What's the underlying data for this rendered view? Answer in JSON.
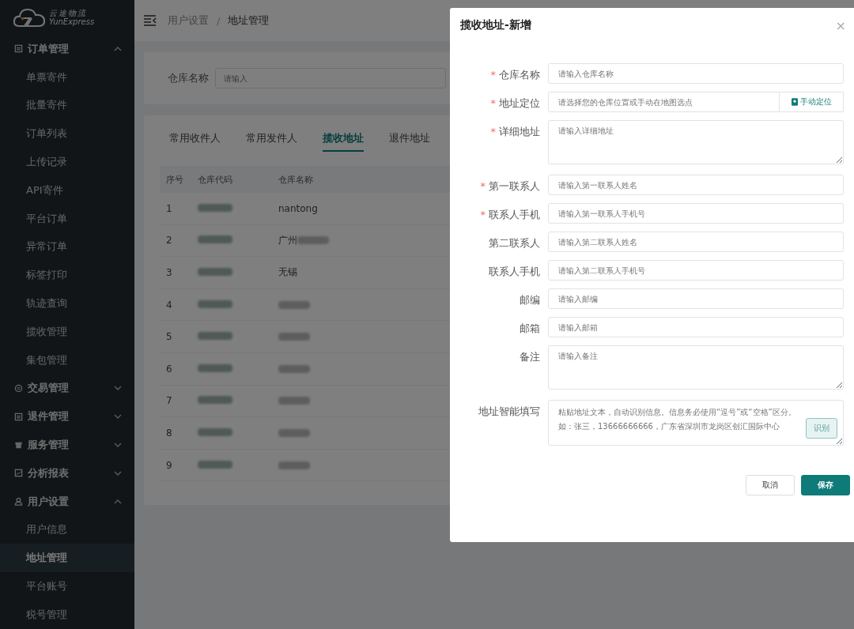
{
  "sidebar": {
    "logo": {
      "cn": "云途物流",
      "en": "YunExpress"
    },
    "groups": [
      {
        "label": "订单管理",
        "kind": "doc",
        "expanded": true,
        "children": [
          {
            "label": "单票寄件",
            "selected": false
          },
          {
            "label": "批量寄件",
            "selected": false
          },
          {
            "label": "订单列表",
            "selected": false
          },
          {
            "label": "上传记录",
            "selected": false
          },
          {
            "label": "API寄件",
            "selected": false
          },
          {
            "label": "平台订单",
            "selected": false
          },
          {
            "label": "异常订单",
            "selected": false
          },
          {
            "label": "标签打印",
            "selected": false
          },
          {
            "label": "轨迹查询",
            "selected": false
          },
          {
            "label": "揽收管理",
            "selected": false
          },
          {
            "label": "集包管理",
            "selected": false
          }
        ]
      },
      {
        "label": "交易管理",
        "kind": "coin",
        "expanded": false
      },
      {
        "label": "退件管理",
        "kind": "doc",
        "expanded": false
      },
      {
        "label": "服务管理",
        "kind": "bin",
        "expanded": false
      },
      {
        "label": "分析报表",
        "kind": "chart",
        "expanded": false
      },
      {
        "label": "用户设置",
        "kind": "user",
        "expanded": true,
        "children": [
          {
            "label": "用户信息",
            "selected": false
          },
          {
            "label": "地址管理",
            "selected": true
          },
          {
            "label": "平台账号",
            "selected": false
          },
          {
            "label": "税号管理",
            "selected": false
          }
        ]
      }
    ]
  },
  "breadcrumb": {
    "items": [
      "用户设置",
      "地址管理"
    ],
    "separator": "/"
  },
  "search": {
    "label": "仓库名称",
    "placeholder": "请输入"
  },
  "tabs": [
    {
      "label": "常用收件人",
      "selected": false
    },
    {
      "label": "常用发件人",
      "selected": false
    },
    {
      "label": "揽收地址",
      "selected": true
    },
    {
      "label": "退件地址",
      "selected": false
    }
  ],
  "table": {
    "columns": [
      "序号",
      "仓库代码",
      "仓库名称"
    ],
    "rows": [
      {
        "no": "1",
        "name": "nantong"
      },
      {
        "no": "2",
        "name": "广州",
        "name_blurred": true
      },
      {
        "no": "3",
        "name": "无锡"
      },
      {
        "no": "4",
        "name_blurred": true
      },
      {
        "no": "5",
        "name_blurred": true
      },
      {
        "no": "6",
        "name_blurred": true
      },
      {
        "no": "7",
        "name_blurred": true
      },
      {
        "no": "8",
        "name_blurred": true
      },
      {
        "no": "9",
        "name_blurred": true
      }
    ]
  },
  "dialog": {
    "title": "揽收地址-新增",
    "close": "×",
    "fields": [
      {
        "label": "仓库名称",
        "required_mark": "*",
        "kind": "input",
        "placeholder": "请输入仓库名称"
      },
      {
        "label": "地址定位",
        "required_mark": "*",
        "kind": "locate",
        "placeholder": "请选择您的仓库位置或手动在地图选点",
        "button": "手动定位"
      },
      {
        "label": "详细地址",
        "required_mark": "*",
        "kind": "textarea",
        "placeholder": "请输入详细地址"
      },
      {
        "label": "第一联系人",
        "required_mark": "*",
        "kind": "input",
        "placeholder": "请输入第一联系人姓名"
      },
      {
        "label": "联系人手机",
        "required_mark": "*",
        "kind": "input",
        "placeholder": "请输入第一联系人手机号"
      },
      {
        "label": "第二联系人",
        "kind": "input",
        "placeholder": "请输入第二联系人姓名"
      },
      {
        "label": "联系人手机",
        "kind": "input",
        "placeholder": "请输入第二联系人手机号"
      },
      {
        "label": "邮编",
        "kind": "input",
        "placeholder": "请输入邮编"
      },
      {
        "label": "邮箱",
        "kind": "input",
        "placeholder": "请输入邮箱"
      },
      {
        "label": "备注",
        "kind": "textarea",
        "placeholder": "请输入备注"
      },
      {
        "label": "地址智能填写",
        "kind": "smart",
        "placeholder": "粘贴地址文本，自动识别信息。信息务必使用“逗号”或“空格”区分。如：张三，13666666666，广东省深圳市龙岗区创汇国际中心",
        "button": "识别"
      }
    ],
    "buttons": [
      {
        "label": "取消",
        "kind": "default"
      },
      {
        "label": "保存",
        "kind": "primary"
      }
    ]
  }
}
